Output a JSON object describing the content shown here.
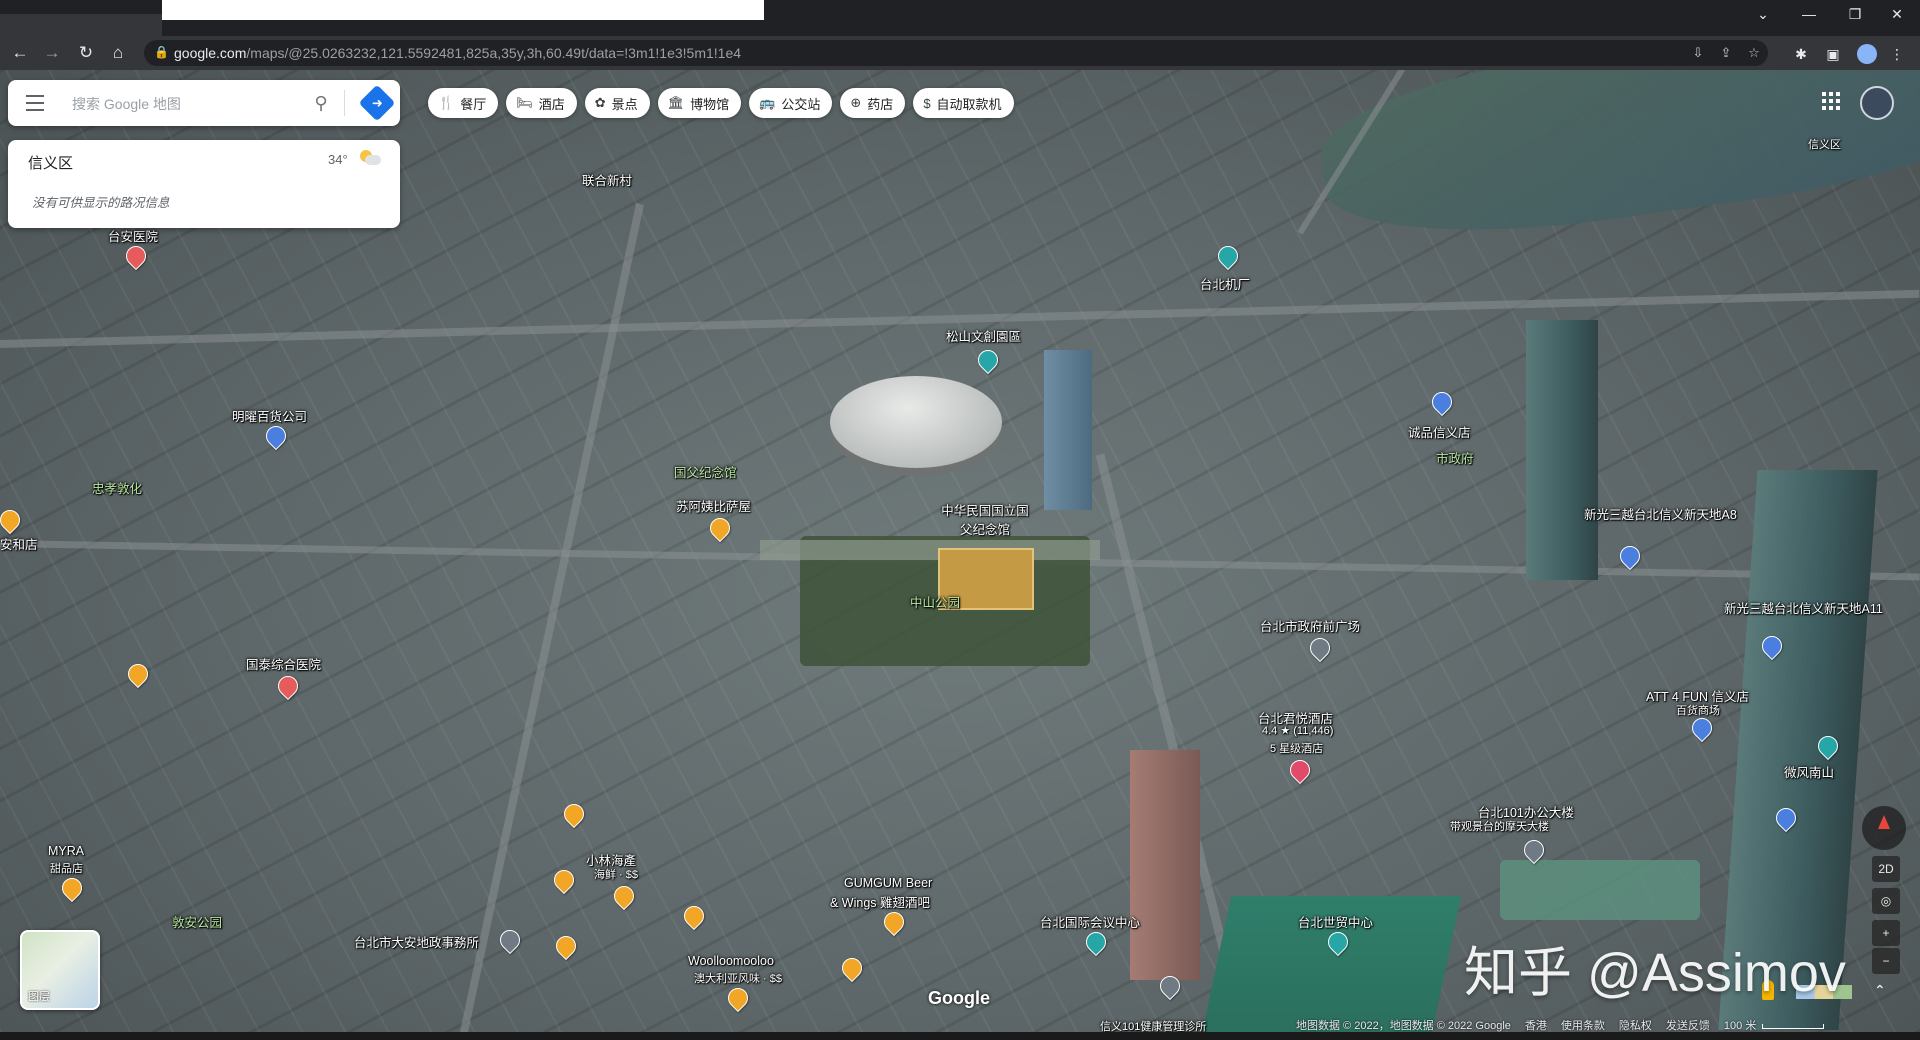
{
  "browser": {
    "url_host": "google.com",
    "url_path": "/maps/@25.0263232,121.5592481,825a,35y,3h,60.49t/data=!3m1!1e3!5m1!1e4"
  },
  "search": {
    "placeholder": "搜索 Google 地图"
  },
  "info_card": {
    "district": "信义区",
    "temperature": "34°",
    "traffic": "没有可供显示的路况信息"
  },
  "chips": [
    {
      "label": "餐厅",
      "icon": "restaurant-icon"
    },
    {
      "label": "酒店",
      "icon": "hotel-icon"
    },
    {
      "label": "景点",
      "icon": "attraction-icon"
    },
    {
      "label": "博物馆",
      "icon": "museum-icon"
    },
    {
      "label": "公交站",
      "icon": "transit-icon"
    },
    {
      "label": "药店",
      "icon": "pharmacy-icon"
    },
    {
      "label": "自动取款机",
      "icon": "atm-icon"
    }
  ],
  "map_labels": {
    "taian": "台安医院",
    "lianhe": "联合新村",
    "songshan": "松山文創園區",
    "taibei_jichang": "台北机厂",
    "mingyao": "明曜百货公司",
    "zhongxiao": "忠孝敦化",
    "guofu_station": "国父纪念馆",
    "sufu": "苏阿姨比萨屋",
    "memorial": "中华民国国立国父纪念馆",
    "zhongshan_park": "中山公园",
    "anhe": "安和店",
    "cathay": "国泰综合医院",
    "chengpin": "诚品信义店",
    "shifu": "市政府",
    "a8": "新光三越台北信义新天地A8",
    "a11": "新光三越台北信义新天地A11",
    "city_square": "台北市政府前广场",
    "grand_hyatt": "台北君悦酒店",
    "grand_hyatt_rating": "4.4 ★ (11,446)",
    "grand_hyatt_type": "5 星级酒店",
    "att4fun": "ATT 4 FUN 信义店",
    "att4fun_sub": "百货商场",
    "weifeng": "微风南山",
    "t101_office": "台北101办公大楼",
    "t101_office_sub": "带观景台的摩天大楼",
    "tpe_icc": "台北国际会议中心",
    "twtc": "台北世贸中心",
    "myra": "MYRA",
    "myra_sub": "甜品店",
    "kobayashi": "小林海產",
    "kobayashi_sub": "海鲜 · $$",
    "gumgum": "GUMGUM Beer",
    "gumgum_2": "& Wings 雞翅酒吧",
    "daan_office": "台北市大安地政事務所",
    "dunan_park": "敦安公园",
    "woolloo": "Woolloomooloo",
    "woolloo_sub": "澳大利亚风味 · $$",
    "health": "信义101健康管理诊所",
    "xinyi_fire": "信义区"
  },
  "watermark": "知乎 @Assimov",
  "google_logo": "Google",
  "layers_label": "图层",
  "footer": {
    "data": "地图数据 © 2022，地图数据 © 2022 Google",
    "region": "香港",
    "terms": "使用条款",
    "privacy": "隐私权",
    "feedback": "发送反馈",
    "scale": "100 米"
  },
  "controls": {
    "mode_2d": "2D",
    "zoom_in": "+",
    "zoom_out": "−"
  }
}
